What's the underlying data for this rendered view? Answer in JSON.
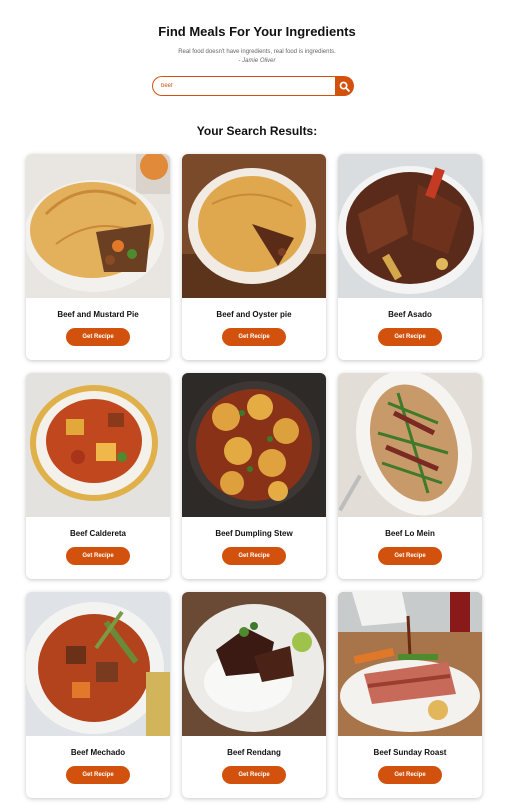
{
  "header": {
    "title": "Find Meals For Your Ingredients",
    "quote": "Real food doesn't have ingredients, real food is ingredients.",
    "author": "- Jamie Oliver"
  },
  "search": {
    "value": "beef",
    "button_icon": "search-icon"
  },
  "results": {
    "title": "Your Search Results:",
    "button_label": "Get Recipe",
    "items": [
      {
        "name": "Beef and Mustard Pie"
      },
      {
        "name": "Beef and Oyster pie"
      },
      {
        "name": "Beef Asado"
      },
      {
        "name": "Beef Caldereta"
      },
      {
        "name": "Beef Dumpling Stew"
      },
      {
        "name": "Beef Lo Mein"
      },
      {
        "name": "Beef Mechado"
      },
      {
        "name": "Beef Rendang"
      },
      {
        "name": "Beef Sunday Roast"
      }
    ]
  },
  "colors": {
    "accent": "#d2520d"
  }
}
